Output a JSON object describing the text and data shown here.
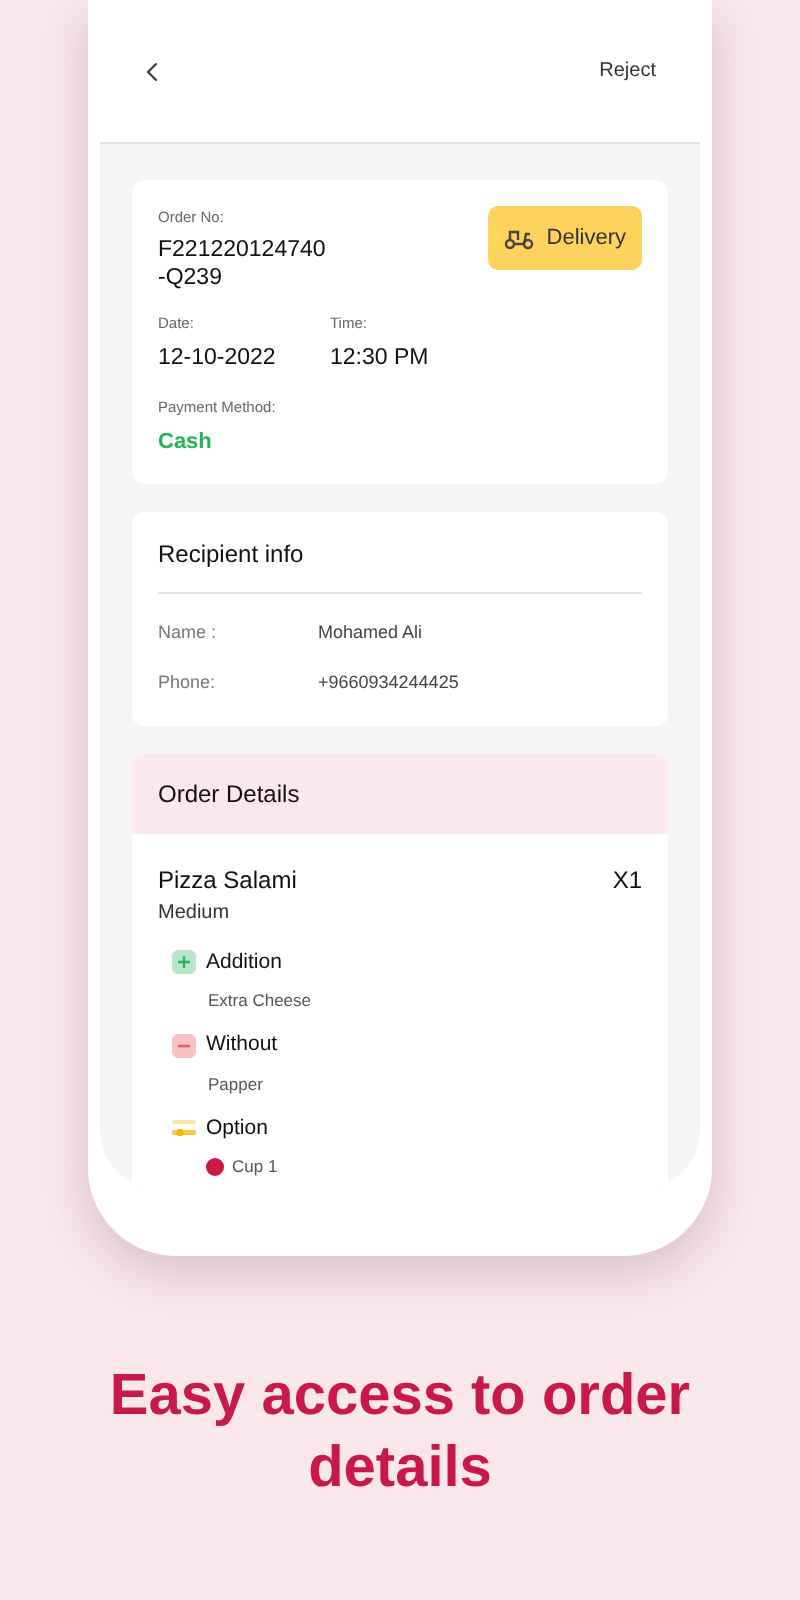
{
  "header": {
    "action": "Reject"
  },
  "order": {
    "number_label": "Order No:",
    "number": "F221220124740\n-Q239",
    "type": "Delivery",
    "date_label": "Date:",
    "date": "12-10-2022",
    "time_label": "Time:",
    "time": "12:30 PM",
    "payment_label": "Payment Method:",
    "payment": "Cash"
  },
  "recipient": {
    "title": "Recipient info",
    "fields": [
      {
        "label": "Name :",
        "value": "Mohamed Ali"
      },
      {
        "label": "Phone:",
        "value": "+9660934244425"
      }
    ]
  },
  "order_details": {
    "title": "Order Details",
    "items": [
      {
        "name": "Pizza Salami",
        "size": "Medium",
        "quantity": "X1",
        "modifiers": [
          {
            "kind": "addition",
            "title": "Addition",
            "entries": [
              "Extra Cheese"
            ]
          },
          {
            "kind": "without",
            "title": "Without",
            "entries": [
              "Papper"
            ]
          },
          {
            "kind": "option",
            "title": "Option",
            "entries": [
              "Cup 1"
            ]
          }
        ]
      }
    ]
  },
  "tagline": "Easy access to order details"
}
